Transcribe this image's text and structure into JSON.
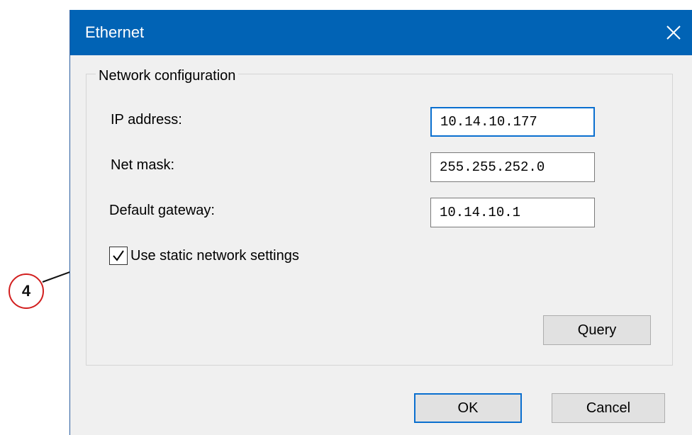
{
  "dialog": {
    "title": "Ethernet",
    "close_icon": "close-icon"
  },
  "network_group": {
    "legend": "Network configuration",
    "ip_label": "IP address:",
    "ip_value": "10.14.10.177",
    "mask_label": "Net mask:",
    "mask_value": "255.255.252.0",
    "gateway_label": "Default gateway:",
    "gateway_value": "10.14.10.1",
    "static_label": "Use static network settings",
    "static_checked": true,
    "query_label": "Query"
  },
  "footer": {
    "ok_label": "OK",
    "cancel_label": "Cancel"
  },
  "callout": {
    "number": "4",
    "color": "#d21f1f"
  },
  "colors": {
    "titlebar": "#0163b5",
    "focus_border": "#0a6fcf",
    "dialog_bg": "#f0f0f0"
  }
}
